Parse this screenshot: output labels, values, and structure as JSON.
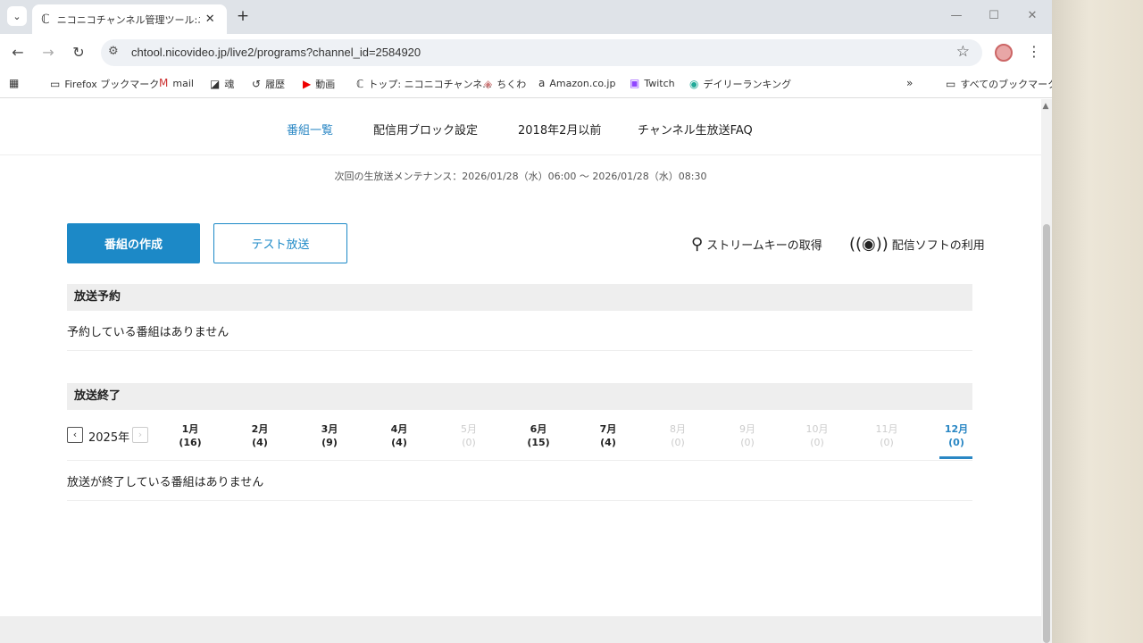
{
  "browser": {
    "tab": {
      "title": "ニコニコチャンネル管理ツール:ニコニコ",
      "favicon": "nico-icon"
    },
    "url": "chtool.nicovideo.jp/live2/programs?channel_id=2584920",
    "bookmarks": [
      {
        "label": "Firefox ブックマーク",
        "icon": "folder-icon"
      },
      {
        "label": "mail",
        "icon": "gmail-icon"
      },
      {
        "label": "魂",
        "icon": "bookmark-icon"
      },
      {
        "label": "履歴",
        "icon": "history-icon"
      },
      {
        "label": "動画",
        "icon": "youtube-icon"
      },
      {
        "label": "トップ: ニコニコチャンネ...",
        "icon": "nico-icon"
      },
      {
        "label": "ちくわ",
        "icon": "chikuwa-icon"
      },
      {
        "label": "Amazon.co.jp",
        "icon": "amazon-icon"
      },
      {
        "label": "Twitch",
        "icon": "twitch-icon"
      },
      {
        "label": "デイリーランキング",
        "icon": "ranking-icon"
      }
    ],
    "all_bookmarks": "すべてのブックマーク"
  },
  "subnav": [
    "番組一覧",
    "配信用ブロック設定",
    "2018年2月以前",
    "チャンネル生放送FAQ"
  ],
  "maintenance": "次回の生放送メンテナンス：2026/01/28（水）06:00 〜 2026/01/28（水）08:30",
  "actions": {
    "create": "番組の作成",
    "test": "テスト放送",
    "stream_key": "ストリームキーの取得",
    "software": "配信ソフトの利用"
  },
  "reserved": {
    "heading": "放送予約",
    "empty": "予約している番組はありません"
  },
  "ended": {
    "heading": "放送終了",
    "year": "2025年",
    "months": [
      {
        "label": "1月",
        "count": "(16)",
        "state": "normal"
      },
      {
        "label": "2月",
        "count": "(4)",
        "state": "normal"
      },
      {
        "label": "3月",
        "count": "(9)",
        "state": "normal"
      },
      {
        "label": "4月",
        "count": "(4)",
        "state": "normal"
      },
      {
        "label": "5月",
        "count": "(0)",
        "state": "disabled"
      },
      {
        "label": "6月",
        "count": "(15)",
        "state": "normal"
      },
      {
        "label": "7月",
        "count": "(4)",
        "state": "normal"
      },
      {
        "label": "8月",
        "count": "(0)",
        "state": "disabled"
      },
      {
        "label": "9月",
        "count": "(0)",
        "state": "disabled"
      },
      {
        "label": "10月",
        "count": "(0)",
        "state": "disabled"
      },
      {
        "label": "11月",
        "count": "(0)",
        "state": "disabled"
      },
      {
        "label": "12月",
        "count": "(0)",
        "state": "active"
      }
    ],
    "empty": "放送が終了している番組はありません"
  },
  "colors": {
    "accent": "#1c89c7",
    "link_active": "#2a87c4",
    "section_bg": "#eeeeee"
  }
}
